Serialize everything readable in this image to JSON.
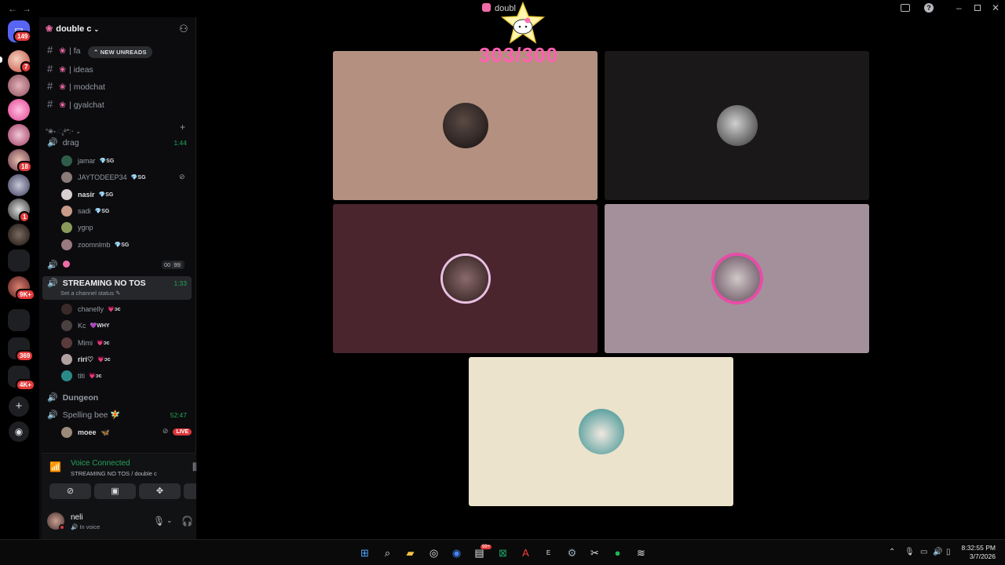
{
  "window": {
    "title": "doubl",
    "back_icon": "arrow-left",
    "forward_icon": "arrow-right"
  },
  "guild_badges": {
    "top": "149",
    "g1": "7",
    "g5": "18",
    "g7": "1",
    "g10": "9K+",
    "g12": "369",
    "g13": "4K+"
  },
  "server": {
    "name": "double c"
  },
  "channels": [
    {
      "label": "| fa"
    },
    {
      "label": "| ideas"
    },
    {
      "label": "| modchat"
    },
    {
      "label": "| gyalchat"
    }
  ],
  "new_unreads": "NEW UNREADS",
  "category_label": "°❀⋆.ೃ࿔*:･",
  "voice_channels": {
    "drag": {
      "name": "drag",
      "time": "1:44",
      "members": [
        {
          "name": "jamar",
          "tag": "SG"
        },
        {
          "name": "JAYTODEEP34",
          "tag": "SG"
        },
        {
          "name": "nasir",
          "tag": "SG"
        },
        {
          "name": "sadi",
          "tag": "SG"
        },
        {
          "name": "ygnp",
          "tag": ""
        },
        {
          "name": "zoomnlmb",
          "tag": "SG"
        }
      ]
    },
    "pink": {
      "count_left": "00",
      "count_right": "99"
    },
    "streaming": {
      "name": "STREAMING NO TOS",
      "time": "1:33",
      "status": "Set a channel status",
      "members": [
        {
          "name": "chanelly",
          "tag": "ɔc"
        },
        {
          "name": "Kc",
          "tag": "WHY"
        },
        {
          "name": "Mimi",
          "tag": "ɔc"
        },
        {
          "name": "riri♡",
          "tag": "ɔc"
        },
        {
          "name": "titi",
          "tag": "ɔc"
        }
      ]
    },
    "dungeon": {
      "name": "Dungeon"
    },
    "spelling": {
      "name": "Spelling bee",
      "time": "52:47",
      "members": [
        {
          "name": "moee",
          "live": "LIVE"
        }
      ]
    }
  },
  "voice_panel": {
    "status": "Voice Connected",
    "location": "STREAMING NO TOS / double c"
  },
  "user": {
    "name": "neli",
    "status": "In voice"
  },
  "stage": {
    "counter": "303/300"
  },
  "colors": {
    "tile1": "#b3907f",
    "tile2": "#1a1818",
    "tile3": "#4a252e",
    "tile4": "#a4909a",
    "tile5": "#ebe3cc",
    "accent_green": "#23a559"
  },
  "clock": {
    "time": "8:32:55 PM",
    "date": "3/7/2026"
  },
  "taskbar_badge": "99+"
}
